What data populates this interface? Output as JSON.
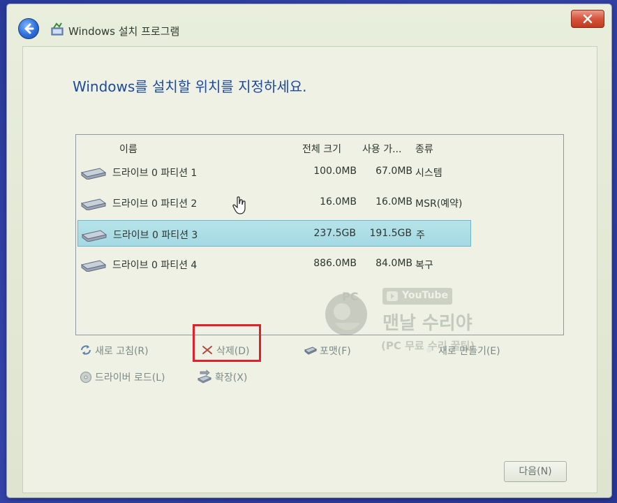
{
  "window": {
    "title": "Windows 설치 프로그램"
  },
  "heading": "Windows를 설치할 위치를 지정하세요.",
  "table": {
    "columns": [
      "이름",
      "전체 크기",
      "사용 가...",
      "종류"
    ],
    "rows": [
      {
        "name": "드라이브 0 파티션 1",
        "total": "100.0MB",
        "free": "67.0MB",
        "type": "시스템",
        "selected": false
      },
      {
        "name": "드라이브 0 파티션 2",
        "total": "16.0MB",
        "free": "16.0MB",
        "type": "MSR(예약)",
        "selected": false
      },
      {
        "name": "드라이브 0 파티션 3",
        "total": "237.5GB",
        "free": "191.5GB",
        "type": "주",
        "selected": true
      },
      {
        "name": "드라이브 0 파티션 4",
        "total": "886.0MB",
        "free": "84.0MB",
        "type": "복구",
        "selected": false
      }
    ]
  },
  "actions": {
    "refresh": "새로 고침(R)",
    "delete": "삭제(D)",
    "format": "포맷(F)",
    "new": "새로 만들기(E)",
    "load_driver": "드라이버 로드(L)",
    "extend": "확장(X)"
  },
  "buttons": {
    "next": "다음(N)"
  },
  "watermark": {
    "badge_text": "PC",
    "youtube": "YouTube",
    "channel": "맨날 수리야",
    "subtitle": "(PC 무료 수리 꿀팁)"
  },
  "colors": {
    "heading": "#1d4a9e",
    "selection": "#a4d9e3",
    "highlight": "#e0202a",
    "desktop": "#2f3ea0"
  }
}
